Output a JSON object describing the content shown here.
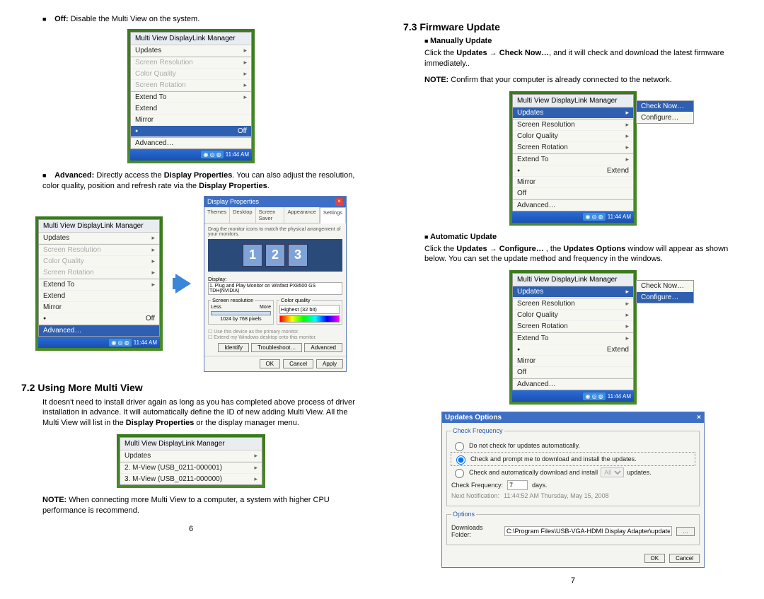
{
  "left": {
    "off_bullet_bold": "Off:",
    "off_bullet_rest": " Disable the Multi View on the system.",
    "adv_bullet_bold": "Advanced:",
    "adv_bullet_mid": " Directly access the ",
    "adv_bullet_b1": "Display Properties",
    "adv_bullet_mid2": ". You can also adjust the resolution, color quality, position and refresh rate via the ",
    "adv_bullet_b2": "Display Properties",
    "adv_bullet_end": ".",
    "h72": "7.2 Using More Multi View",
    "p72a": "It doesn't need to install driver again as long as you has completed above process of driver installation in advance. It will automatically define the ID of new adding Multi View. All the Multi View will list in the ",
    "p72b1": "Display Properties",
    "p72mid": " or the display manager menu.",
    "note_bold": "NOTE:",
    "note_rest": " When connecting more Multi View to a computer, a system with higher CPU performance is recommend.",
    "pagenum": "6"
  },
  "right": {
    "h73": "7.3 Firmware Update",
    "sub_manual": "Manually Update",
    "p_manual_a": "Click the ",
    "p_manual_b1": "Updates",
    "p_manual_arrow": " → ",
    "p_manual_b2": "Check Now…",
    "p_manual_c": ", and it will check and download the latest firmware immediately..",
    "note_bold": "NOTE:",
    "note_rest": " Confirm that your computer is already connected to the network.",
    "sub_auto": "Automatic Update",
    "p_auto_a": "Click the ",
    "p_auto_b1": "Updates",
    "p_auto_arrow": " → ",
    "p_auto_b2": "Configure…",
    "p_auto_c": " , the ",
    "p_auto_b3": "Updates Options",
    "p_auto_d": " window will appear as shown below. You can set the update method and frequency in the windows.",
    "pagenum": "7"
  },
  "menu": {
    "title": "Multi View DisplayLink Manager",
    "updates": "Updates",
    "screen_res": "Screen Resolution",
    "color_quality": "Color Quality",
    "screen_rotation": "Screen Rotation",
    "extend_to": "Extend To",
    "extend": "Extend",
    "mirror": "Mirror",
    "off": "Off",
    "advanced": "Advanced…",
    "mview2": "2. M-View (USB_0211-000001)",
    "mview3": "3. M-View (USB_0211-000000)"
  },
  "submenu": {
    "check_now": "Check Now…",
    "configure": "Configure…"
  },
  "taskbar": {
    "time": "11:44 AM"
  },
  "dp": {
    "title": "Display Properties",
    "tabs": [
      "Themes",
      "Desktop",
      "Screen Saver",
      "Appearance",
      "Settings"
    ],
    "drag": "Drag the monitor icons to match the physical arrangement of your monitors.",
    "display_label": "Display:",
    "display_sel": "1. Plug and Play Monitor on Winfast PX8500 GS TDH(NVIDIA)",
    "res_legend": "Screen resolution",
    "res_less": "Less",
    "res_more": "More",
    "res_val": "1024 by 768 pixels",
    "cq_legend": "Color quality",
    "cq_val": "Highest (32 bit)",
    "cb1": "Use this device as the primary monitor.",
    "cb2": "Extend my Windows desktop onto this monitor.",
    "identify": "Identify",
    "troubleshoot": "Troubleshoot…",
    "advanced": "Advanced",
    "ok": "OK",
    "cancel": "Cancel",
    "apply": "Apply"
  },
  "opt": {
    "title": "Updates Options",
    "freq_legend": "Check Frequency",
    "r1": "Do not check for updates automatically.",
    "r2": "Check and prompt me to download and install the updates.",
    "r3_a": "Check and automatically download and install",
    "r3_sel": "All",
    "r3_b": "updates.",
    "freq_label": "Check Frequency:",
    "freq_val": "7",
    "freq_unit": "days.",
    "next_label": "Next Notification:",
    "next_val": "11:44:52 AM Thursday, May 15, 2008",
    "opts_legend": "Options",
    "dl_label": "Downloads Folder:",
    "dl_val": "C:\\Program Files\\USB-VGA-HDMI Display Adapter\\updates",
    "ok": "OK",
    "cancel": "Cancel"
  }
}
